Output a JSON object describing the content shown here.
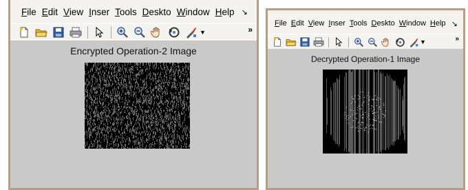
{
  "windows": [
    {
      "id": "w1",
      "menu": [
        "File",
        "Edit",
        "View",
        "Inser",
        "Tools",
        "Deskto",
        "Window",
        "Help"
      ],
      "image_title": "Encrypted Operation-2 Image"
    },
    {
      "id": "w2",
      "menu": [
        "File",
        "Edit",
        "View",
        "Inser",
        "Tools",
        "Deskto",
        "Window",
        "Help"
      ],
      "image_title": "Decrypted Operation-1 Image"
    }
  ],
  "toolbar_icons": [
    "new-file-icon",
    "open-folder-icon",
    "save-icon",
    "print-icon",
    "pointer-icon",
    "zoom-in-icon",
    "zoom-out-icon",
    "pan-hand-icon",
    "rotate-3d-icon",
    "data-cursor-icon"
  ],
  "colors": {
    "frame": "#b59e85",
    "figure_background": "#c9c9c9",
    "image_background": "#000000"
  }
}
